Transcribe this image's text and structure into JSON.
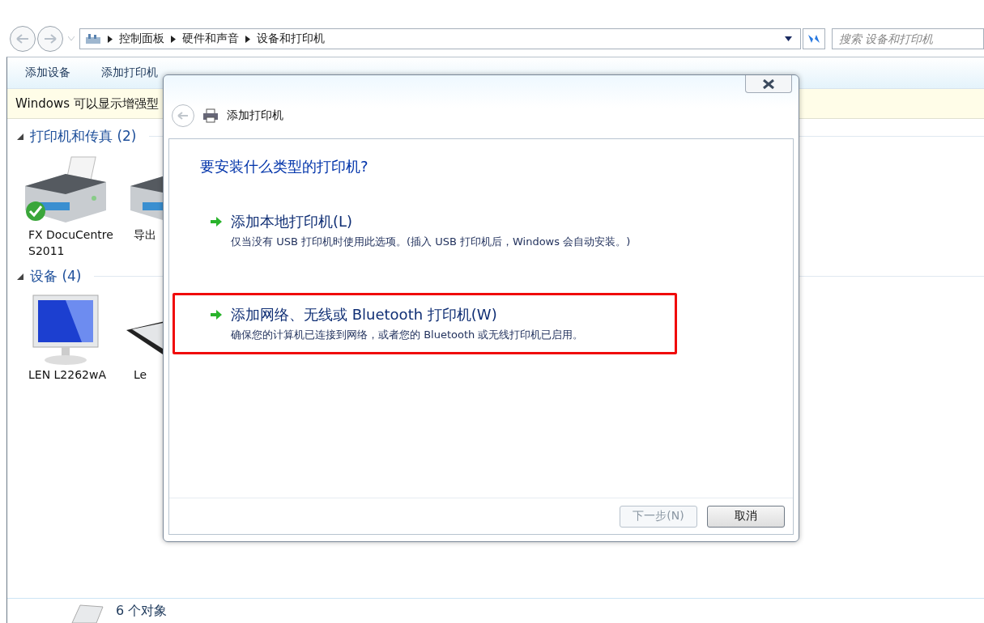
{
  "address_bar": {
    "path": [
      "控制面板",
      "硬件和声音",
      "设备和打印机"
    ]
  },
  "search": {
    "placeholder": "搜索 设备和打印机"
  },
  "toolbar": {
    "buttons": [
      "添加设备",
      "添加打印机"
    ]
  },
  "info_bar": {
    "text": "Windows 可以显示增强型"
  },
  "groups": [
    {
      "title": "打印机和传真 (2)",
      "expanded": true,
      "items": [
        {
          "kind": "printer",
          "label": "FX DocuCentre S2011",
          "default": true
        },
        {
          "kind": "printer",
          "label": "导出",
          "default": false
        }
      ]
    },
    {
      "title": "设备 (4)",
      "expanded": true,
      "items": [
        {
          "kind": "monitor",
          "label": "LEN L2262wA",
          "default": false
        },
        {
          "kind": "keyboard",
          "label": "Le",
          "default": false
        }
      ]
    }
  ],
  "status_bar": {
    "text": "6 个对象"
  },
  "dialog": {
    "title": "添加打印机",
    "question": "要安装什么类型的打印机?",
    "options": [
      {
        "title": "添加本地打印机(L)",
        "description": "仅当没有 USB 打印机时使用此选项。(插入 USB 打印机后，Windows 会自动安装。)",
        "highlighted": false
      },
      {
        "title": "添加网络、无线或 Bluetooth 打印机(W)",
        "description": "确保您的计算机已连接到网络，或者您的 Bluetooth 或无线打印机已启用。",
        "highlighted": true
      }
    ],
    "buttons": [
      {
        "label": "下一步(N)",
        "disabled": true
      },
      {
        "label": "取消",
        "disabled": false
      }
    ]
  }
}
